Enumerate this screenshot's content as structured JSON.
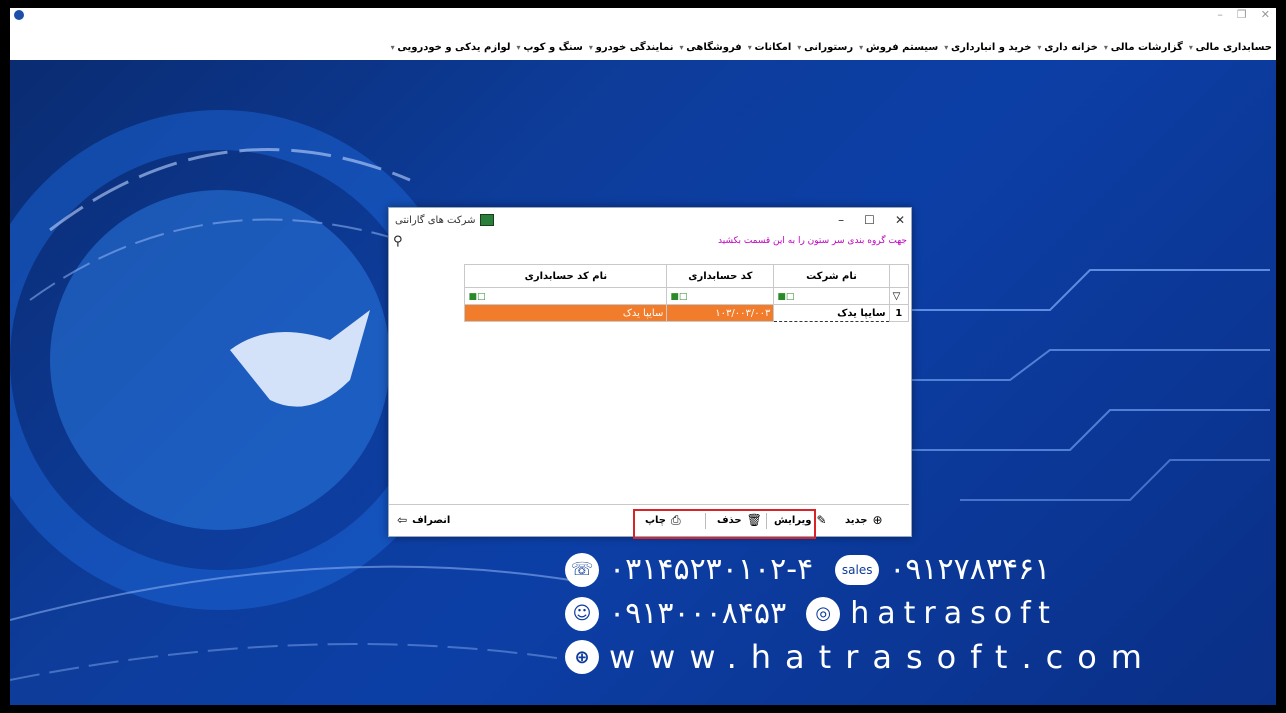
{
  "menubar": {
    "items": [
      "حسابداری مالی",
      "گزارشات مالی",
      "خزانه داری",
      "خرید و انبارداری",
      "سیستم فروش",
      "رستورانی",
      "امکانات",
      "فروشگاهی",
      "نمایندگی خودرو",
      "سنگ و کوپ",
      "لوازم یدکی و خودرویی"
    ]
  },
  "dialog": {
    "title": "شرکت های گارانتی",
    "group_hint": "جهت گروه بندی سر ستون را به این قسمت بکشید",
    "columns": [
      "نام شرکت",
      "کد حسابداری",
      "نام کد حسابداری"
    ],
    "rows": [
      {
        "num": "1",
        "company": "سایپا یدک",
        "code": "۱۰۳/۰۰۳/۰۰۳",
        "code_name": "سایپا یدک"
      }
    ],
    "buttons": {
      "new": "جدید",
      "edit": "ویرایش",
      "delete": "حذف",
      "print": "چاپ",
      "cancel": "انصراف"
    }
  },
  "contact": {
    "phone1": "۰۳۱۴۵۲۳۰۱۰۲-۴",
    "sales_label": "sales",
    "phone2": "۰۹۱۲۷۸۳۴۶۱",
    "phone3": "۰۹۱۳۰۰۰۸۴۵۳",
    "instagram": "hatrasoft",
    "website": "www.hatrasoft.com"
  },
  "colors": {
    "accent": "#f07c2c",
    "highlight_box": "#d8232a",
    "background": "#0c3fa6"
  }
}
